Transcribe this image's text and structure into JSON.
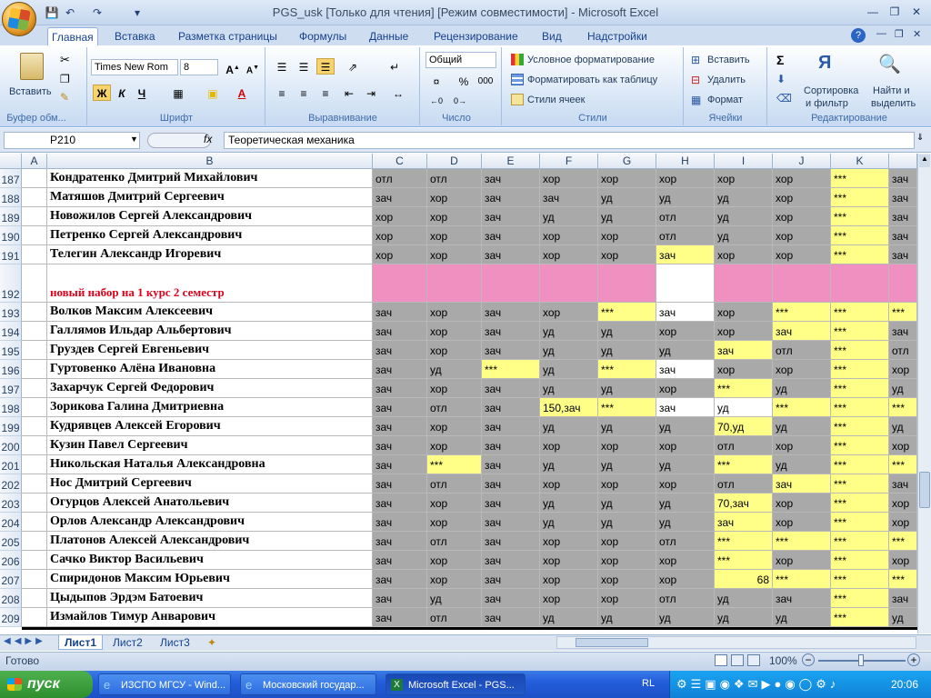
{
  "window": {
    "title": "PGS_usk  [Только для чтения]  [Режим совместимости] - Microsoft Excel"
  },
  "ribbon": {
    "tabs": [
      "Главная",
      "Вставка",
      "Разметка страницы",
      "Формулы",
      "Данные",
      "Рецензирование",
      "Вид",
      "Надстройки"
    ],
    "clipboard": {
      "paste": "Вставить",
      "label": "Буфер обм..."
    },
    "font": {
      "name": "Times New Rom",
      "size": "8",
      "bold": "Ж",
      "italic": "К",
      "underline": "Ч",
      "label": "Шрифт"
    },
    "alignment": {
      "label": "Выравнивание"
    },
    "number": {
      "format": "Общий",
      "percent": "%",
      "thousands": "000",
      "label": "Число"
    },
    "styles": {
      "conditional": "Условное форматирование",
      "table": "Форматировать как таблицу",
      "cell": "Стили ячеек",
      "label": "Стили"
    },
    "cells": {
      "insert": "Вставить",
      "delete": "Удалить",
      "format": "Формат",
      "label": "Ячейки"
    },
    "editing": {
      "sort1": "Сортировка",
      "sort2": "и фильтр",
      "find1": "Найти и",
      "find2": "выделить",
      "label": "Редактирование"
    }
  },
  "formula_bar": {
    "name_box": "P210",
    "fx": "fx",
    "content": "Теоретическая механика"
  },
  "columns": [
    "A",
    "B",
    "C",
    "D",
    "E",
    "F",
    "G",
    "H",
    "I",
    "J",
    "K"
  ],
  "rows": [
    {
      "n": "187",
      "name": "Кондратенко Дмитрий Михайлович",
      "cells": [
        [
          "отл",
          "g"
        ],
        [
          "отл",
          "g"
        ],
        [
          "зач",
          "g"
        ],
        [
          "хор",
          "g"
        ],
        [
          "хор",
          "g"
        ],
        [
          "хор",
          "g"
        ],
        [
          "хор",
          "g"
        ],
        [
          "хор",
          "g"
        ],
        [
          "***",
          "y"
        ],
        [
          "зач",
          "g"
        ]
      ]
    },
    {
      "n": "188",
      "name": "Матяшов Дмитрий Сергеевич",
      "cells": [
        [
          "зач",
          "g"
        ],
        [
          "хор",
          "g"
        ],
        [
          "зач",
          "g"
        ],
        [
          "зач",
          "g"
        ],
        [
          "уд",
          "g"
        ],
        [
          "уд",
          "g"
        ],
        [
          "уд",
          "g"
        ],
        [
          "хор",
          "g"
        ],
        [
          "***",
          "y"
        ],
        [
          "зач",
          "g"
        ]
      ]
    },
    {
      "n": "189",
      "name": "Новожилов Сергей Александрович",
      "cells": [
        [
          "хор",
          "g"
        ],
        [
          "хор",
          "g"
        ],
        [
          "зач",
          "g"
        ],
        [
          "уд",
          "g"
        ],
        [
          "уд",
          "g"
        ],
        [
          "отл",
          "g"
        ],
        [
          "уд",
          "g"
        ],
        [
          "хор",
          "g"
        ],
        [
          "***",
          "y"
        ],
        [
          "зач",
          "g"
        ]
      ]
    },
    {
      "n": "190",
      "name": "Петренко Сергей Александрович",
      "cells": [
        [
          "хор",
          "g"
        ],
        [
          "хор",
          "g"
        ],
        [
          "зач",
          "g"
        ],
        [
          "хор",
          "g"
        ],
        [
          "хор",
          "g"
        ],
        [
          "отл",
          "g"
        ],
        [
          "уд",
          "g"
        ],
        [
          "хор",
          "g"
        ],
        [
          "***",
          "y"
        ],
        [
          "зач",
          "g"
        ]
      ]
    },
    {
      "n": "191",
      "name": "Телегин Александр Игоревич",
      "cells": [
        [
          "хор",
          "g"
        ],
        [
          "хор",
          "g"
        ],
        [
          "зач",
          "g"
        ],
        [
          "хор",
          "g"
        ],
        [
          "хор",
          "g"
        ],
        [
          "зач",
          "y"
        ],
        [
          "хор",
          "g"
        ],
        [
          "хор",
          "g"
        ],
        [
          "***",
          "y"
        ],
        [
          "зач",
          "g"
        ]
      ]
    },
    {
      "n": "192",
      "name": "новый набор на 1 курс 2 семестр",
      "special": "header",
      "cells": [
        [
          "",
          "p"
        ],
        [
          "",
          "p"
        ],
        [
          "",
          "p"
        ],
        [
          "",
          "p"
        ],
        [
          "",
          "p"
        ],
        [
          "",
          "w"
        ],
        [
          "",
          "p"
        ],
        [
          "",
          "p"
        ],
        [
          "",
          "p"
        ],
        [
          "",
          "p"
        ]
      ]
    },
    {
      "n": "193",
      "name": "Волков Максим Алексеевич",
      "cells": [
        [
          "зач",
          "g"
        ],
        [
          "хор",
          "g"
        ],
        [
          "зач",
          "g"
        ],
        [
          "хор",
          "g"
        ],
        [
          "***",
          "y"
        ],
        [
          "зач",
          "w"
        ],
        [
          "хор",
          "g"
        ],
        [
          "***",
          "y"
        ],
        [
          "***",
          "y"
        ],
        [
          "***",
          "y"
        ]
      ]
    },
    {
      "n": "194",
      "name": "Галлямов Ильдар Альбертович",
      "cells": [
        [
          "зач",
          "g"
        ],
        [
          "хор",
          "g"
        ],
        [
          "зач",
          "g"
        ],
        [
          "уд",
          "g"
        ],
        [
          "уд",
          "g"
        ],
        [
          "хор",
          "g"
        ],
        [
          "хор",
          "g"
        ],
        [
          "зач",
          "y"
        ],
        [
          "***",
          "y"
        ],
        [
          "зач",
          "g"
        ]
      ]
    },
    {
      "n": "195",
      "name": "Груздев Сергей Евгеньевич",
      "cells": [
        [
          "зач",
          "g"
        ],
        [
          "хор",
          "g"
        ],
        [
          "зач",
          "g"
        ],
        [
          "уд",
          "g"
        ],
        [
          "уд",
          "g"
        ],
        [
          "уд",
          "g"
        ],
        [
          "зач",
          "y"
        ],
        [
          "отл",
          "g"
        ],
        [
          "***",
          "y"
        ],
        [
          "отл",
          "g"
        ]
      ]
    },
    {
      "n": "196",
      "name": "Гуртовенко Алёна Ивановна",
      "cells": [
        [
          "зач",
          "g"
        ],
        [
          "уд",
          "g"
        ],
        [
          "***",
          "y"
        ],
        [
          "уд",
          "g"
        ],
        [
          "***",
          "y"
        ],
        [
          "зач",
          "w"
        ],
        [
          "хор",
          "g"
        ],
        [
          "хор",
          "g"
        ],
        [
          "***",
          "y"
        ],
        [
          "хор",
          "g"
        ]
      ]
    },
    {
      "n": "197",
      "name": "Захарчук Сергей Федорович",
      "cells": [
        [
          "зач",
          "g"
        ],
        [
          "хор",
          "g"
        ],
        [
          "зач",
          "g"
        ],
        [
          "уд",
          "g"
        ],
        [
          "уд",
          "g"
        ],
        [
          "хор",
          "g"
        ],
        [
          "***",
          "y"
        ],
        [
          "уд",
          "g"
        ],
        [
          "***",
          "y"
        ],
        [
          "уд",
          "g"
        ]
      ]
    },
    {
      "n": "198",
      "name": "Зорикова Галина Дмитриевна",
      "cells": [
        [
          "зач",
          "g"
        ],
        [
          "отл",
          "g"
        ],
        [
          "зач",
          "g"
        ],
        [
          "150,зач",
          "y"
        ],
        [
          "***",
          "y"
        ],
        [
          "зач",
          "w"
        ],
        [
          "уд",
          "w"
        ],
        [
          "***",
          "y"
        ],
        [
          "***",
          "y"
        ],
        [
          "***",
          "y"
        ]
      ]
    },
    {
      "n": "199",
      "name": "Кудрявцев Алексей Егорович",
      "cells": [
        [
          "зач",
          "g"
        ],
        [
          "хор",
          "g"
        ],
        [
          "зач",
          "g"
        ],
        [
          "уд",
          "g"
        ],
        [
          "уд",
          "g"
        ],
        [
          "уд",
          "g"
        ],
        [
          "70,уд",
          "y"
        ],
        [
          "уд",
          "g"
        ],
        [
          "***",
          "y"
        ],
        [
          "уд",
          "g"
        ]
      ]
    },
    {
      "n": "200",
      "name": "Кузин Павел Сергеевич",
      "cells": [
        [
          "зач",
          "g"
        ],
        [
          "хор",
          "g"
        ],
        [
          "зач",
          "g"
        ],
        [
          "хор",
          "g"
        ],
        [
          "хор",
          "g"
        ],
        [
          "хор",
          "g"
        ],
        [
          "отл",
          "g"
        ],
        [
          "хор",
          "g"
        ],
        [
          "***",
          "y"
        ],
        [
          "хор",
          "g"
        ]
      ]
    },
    {
      "n": "201",
      "name": "Никольская Наталья Александровна",
      "cells": [
        [
          "зач",
          "g"
        ],
        [
          "***",
          "y"
        ],
        [
          "зач",
          "g"
        ],
        [
          "уд",
          "g"
        ],
        [
          "уд",
          "g"
        ],
        [
          "уд",
          "g"
        ],
        [
          "***",
          "y"
        ],
        [
          "уд",
          "g"
        ],
        [
          "***",
          "y"
        ],
        [
          "***",
          "y"
        ]
      ]
    },
    {
      "n": "202",
      "name": "Нос Дмитрий Сергеевич",
      "cells": [
        [
          "зач",
          "g"
        ],
        [
          "отл",
          "g"
        ],
        [
          "зач",
          "g"
        ],
        [
          "хор",
          "g"
        ],
        [
          "хор",
          "g"
        ],
        [
          "хор",
          "g"
        ],
        [
          "отл",
          "g"
        ],
        [
          "зач",
          "y"
        ],
        [
          "***",
          "y"
        ],
        [
          "зач",
          "g"
        ]
      ]
    },
    {
      "n": "203",
      "name": "Огурцов Алексей Анатольевич",
      "cells": [
        [
          "зач",
          "g"
        ],
        [
          "хор",
          "g"
        ],
        [
          "зач",
          "g"
        ],
        [
          "уд",
          "g"
        ],
        [
          "уд",
          "g"
        ],
        [
          "уд",
          "g"
        ],
        [
          "70,зач",
          "y"
        ],
        [
          "хор",
          "g"
        ],
        [
          "***",
          "y"
        ],
        [
          "хор",
          "g"
        ]
      ]
    },
    {
      "n": "204",
      "name": "Орлов Александр Александрович",
      "cells": [
        [
          "зач",
          "g"
        ],
        [
          "хор",
          "g"
        ],
        [
          "зач",
          "g"
        ],
        [
          "уд",
          "g"
        ],
        [
          "уд",
          "g"
        ],
        [
          "уд",
          "g"
        ],
        [
          "зач",
          "y"
        ],
        [
          "хор",
          "g"
        ],
        [
          "***",
          "y"
        ],
        [
          "хор",
          "g"
        ]
      ]
    },
    {
      "n": "205",
      "name": "Платонов Алексей Александрович",
      "cells": [
        [
          "зач",
          "g"
        ],
        [
          "отл",
          "g"
        ],
        [
          "зач",
          "g"
        ],
        [
          "хор",
          "g"
        ],
        [
          "хор",
          "g"
        ],
        [
          "отл",
          "g"
        ],
        [
          "***",
          "y"
        ],
        [
          "***",
          "y"
        ],
        [
          "***",
          "y"
        ],
        [
          "***",
          "y"
        ]
      ]
    },
    {
      "n": "206",
      "name": "Сачко Виктор Васильевич",
      "cells": [
        [
          "зач",
          "g"
        ],
        [
          "хор",
          "g"
        ],
        [
          "зач",
          "g"
        ],
        [
          "хор",
          "g"
        ],
        [
          "хор",
          "g"
        ],
        [
          "хор",
          "g"
        ],
        [
          "***",
          "y"
        ],
        [
          "хор",
          "g"
        ],
        [
          "***",
          "y"
        ],
        [
          "хор",
          "g"
        ]
      ]
    },
    {
      "n": "207",
      "name": "Спиридонов Максим Юрьевич",
      "cells": [
        [
          "зач",
          "g"
        ],
        [
          "хор",
          "g"
        ],
        [
          "зач",
          "g"
        ],
        [
          "хор",
          "g"
        ],
        [
          "хор",
          "g"
        ],
        [
          "хор",
          "g"
        ],
        [
          "68",
          "y",
          "r"
        ],
        [
          "***",
          "y"
        ],
        [
          "***",
          "y"
        ],
        [
          "***",
          "y"
        ]
      ]
    },
    {
      "n": "208",
      "name": "Цыдыпов Эрдэм Батоевич",
      "cells": [
        [
          "зач",
          "g"
        ],
        [
          "уд",
          "g"
        ],
        [
          "зач",
          "g"
        ],
        [
          "хор",
          "g"
        ],
        [
          "хор",
          "g"
        ],
        [
          "отл",
          "g"
        ],
        [
          "уд",
          "g"
        ],
        [
          "зач",
          "g"
        ],
        [
          "***",
          "y"
        ],
        [
          "зач",
          "g"
        ]
      ]
    },
    {
      "n": "209",
      "name": "Измайлов Тимур Анварович",
      "cells": [
        [
          "зач",
          "g"
        ],
        [
          "отл",
          "g"
        ],
        [
          "зач",
          "g"
        ],
        [
          "уд",
          "g"
        ],
        [
          "уд",
          "g"
        ],
        [
          "уд",
          "g"
        ],
        [
          "уд",
          "g"
        ],
        [
          "уд",
          "g"
        ],
        [
          "***",
          "y"
        ],
        [
          "уд",
          "g"
        ]
      ]
    }
  ],
  "sheets": [
    "Лист1",
    "Лист2",
    "Лист3"
  ],
  "status": {
    "ready": "Готово",
    "zoom": "100%"
  },
  "taskbar": {
    "start": "пуск",
    "items": [
      "ИЗСПО МГСУ - Wind...",
      "Московский государ...",
      "Microsoft Excel - PGS..."
    ],
    "lang": "RL",
    "clock": "20:06"
  }
}
